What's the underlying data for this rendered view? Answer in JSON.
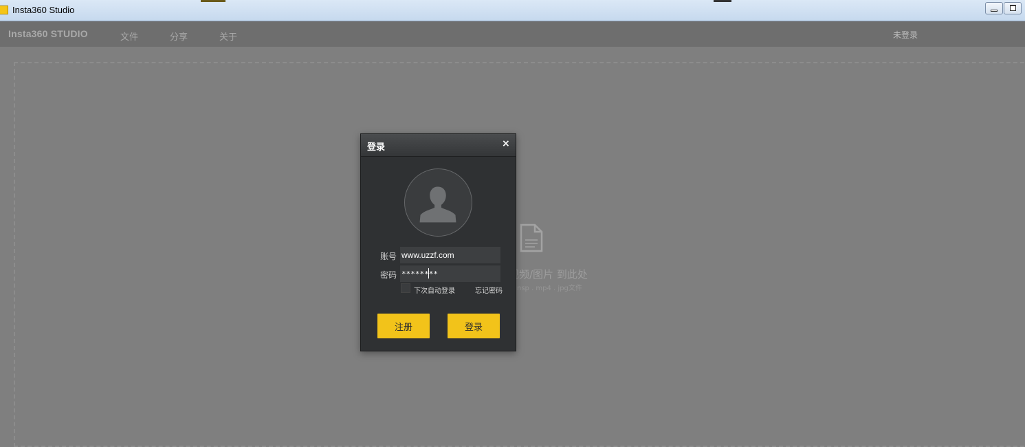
{
  "window": {
    "title": "Insta360 Studio"
  },
  "menubar": {
    "brand": "Insta360 STUDIO",
    "items": [
      {
        "label": "文件"
      },
      {
        "label": "分享"
      },
      {
        "label": "关于"
      }
    ],
    "user_status": "未登录"
  },
  "dropzone": {
    "hint": "视频/图片 到此处",
    "types": "nsp . mp4 . jpg文件",
    "icon": "document-icon"
  },
  "login_dialog": {
    "title": "登录",
    "close_glyph": "×",
    "avatar_icon": "user-silhouette-icon",
    "account_label": "账号",
    "account_value": "www.uzzf.com",
    "password_label": "密码",
    "password_value": "********",
    "auto_login_label": "下次自动登录",
    "auto_login_checked": false,
    "forgot_password": "忘记密码",
    "register_button": "注册",
    "login_button": "登录"
  },
  "colors": {
    "accent": "#f2c31a",
    "background": "#7f7f7f",
    "menubar": "#6e6e6e",
    "dialog": "#2f3133"
  }
}
